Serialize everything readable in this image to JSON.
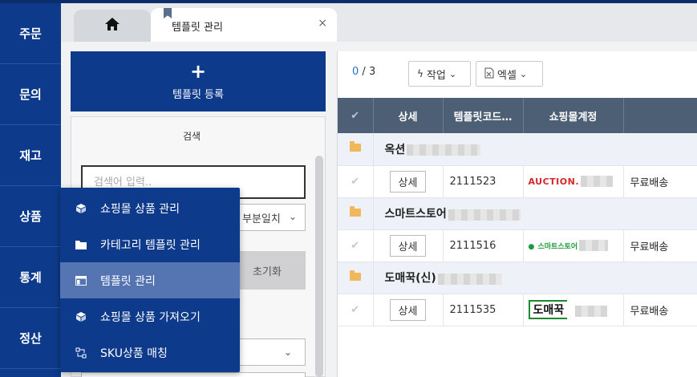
{
  "leftnav": {
    "items": [
      {
        "label": "주문"
      },
      {
        "label": "문의"
      },
      {
        "label": "재고"
      },
      {
        "label": "상품"
      },
      {
        "label": "통계"
      },
      {
        "label": "정산"
      }
    ]
  },
  "tabs": {
    "home_icon": "home-icon",
    "active_title": "템플릿 관리",
    "close_glyph": "×"
  },
  "left_panel": {
    "register_plus": "+",
    "register_label": "템플릿 등록",
    "search_title": "검색",
    "search_placeholder": "검색어 입력..",
    "match_select_value": "부분일치",
    "reset_label": "초기화"
  },
  "toolbar": {
    "count_current": "0",
    "count_sep": "/",
    "count_total": "3",
    "action_label": "작업",
    "excel_label": "엑셀"
  },
  "table": {
    "headers": [
      "",
      "상세",
      "템플릿코드…",
      "쇼핑몰계정",
      ""
    ],
    "groups": [
      {
        "name": "옥션",
        "rows": [
          {
            "detail": "상세",
            "code": "2111523",
            "mall_logo": "AUCTION.",
            "shipping": "무료배송"
          }
        ]
      },
      {
        "name": "스마트스토어",
        "rows": [
          {
            "detail": "상세",
            "code": "2111516",
            "mall_logo": "스마트스토어",
            "shipping": "무료배송"
          }
        ]
      },
      {
        "name": "도매꾹(신)",
        "rows": [
          {
            "detail": "상세",
            "code": "2111535",
            "mall_logo": "도매꾹",
            "shipping": "무료배송"
          }
        ]
      }
    ]
  },
  "dropdown": {
    "items": [
      {
        "label": "쇼핑몰 상품 관리",
        "icon": "cube-icon"
      },
      {
        "label": "카테고리 템플릿 관리",
        "icon": "folder-icon"
      },
      {
        "label": "템플릿 관리",
        "icon": "template-icon"
      },
      {
        "label": "쇼핑몰 상품 가져오기",
        "icon": "cube-icon"
      },
      {
        "label": "SKU상품 매칭",
        "icon": "sku-match-icon"
      }
    ]
  },
  "colors": {
    "nav": "#0d3a8a",
    "header": "#4d5f74",
    "active_menu": "#5474b2"
  }
}
